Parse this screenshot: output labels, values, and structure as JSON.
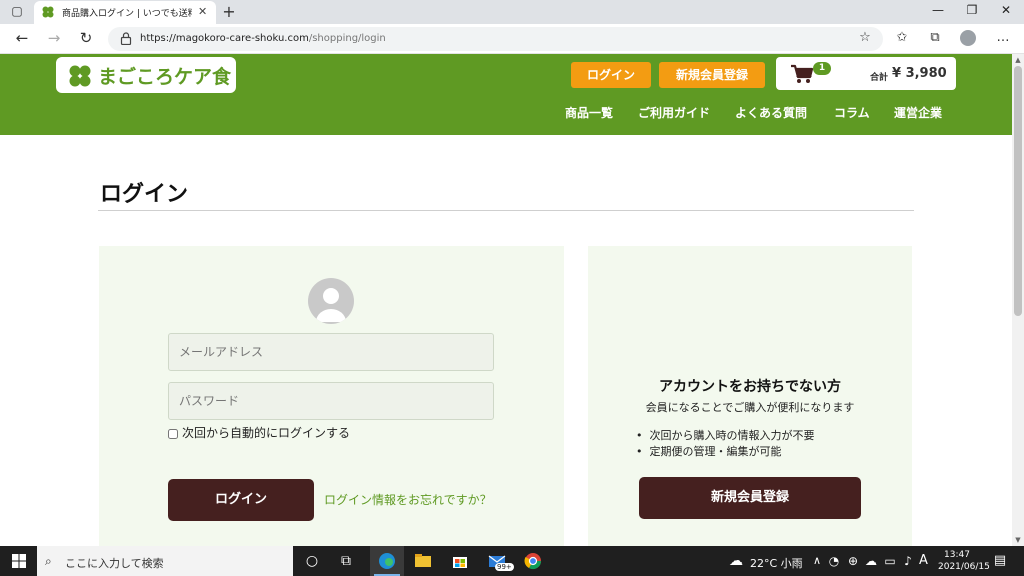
{
  "browser": {
    "tab_title": "商品購入ログイン | いつでも送料無料",
    "url_domain": "https://magokoro-care-shoku.com",
    "url_path": "/shopping/login"
  },
  "header": {
    "logo_text": "まごころケア食",
    "login_button": "ログイン",
    "register_button": "新規会員登録",
    "cart_count": "1",
    "cart_total_label": "合計",
    "cart_total": "¥ 3,980",
    "nav": [
      "商品一覧",
      "ご利用ガイド",
      "よくある質問",
      "コラム",
      "運営企業"
    ]
  },
  "main": {
    "title": "ログイン",
    "login": {
      "email_placeholder": "メールアドレス",
      "password_placeholder": "パスワード",
      "remember_label": "次回から自動的にログインする",
      "submit_label": "ログイン",
      "forgot_link": "ログイン情報をお忘れですか？"
    },
    "register": {
      "heading": "アカウントをお持ちでない方",
      "subtext": "会員になることでご購入が便利になります",
      "benefits": [
        "次回から購入時の情報入力が不要",
        "定期便の管理・編集が可能"
      ],
      "button": "新規会員登録"
    }
  },
  "taskbar": {
    "search_placeholder": "ここに入力して検索",
    "mail_badge": "99+",
    "weather": "22°C  小雨",
    "ime": "A",
    "time": "13:47",
    "date": "2021/06/15"
  },
  "colors": {
    "brand_green": "#5f9a23",
    "orange": "#f39c12",
    "dark_brown": "#45201f",
    "panel_bg": "#f3f9ee"
  }
}
